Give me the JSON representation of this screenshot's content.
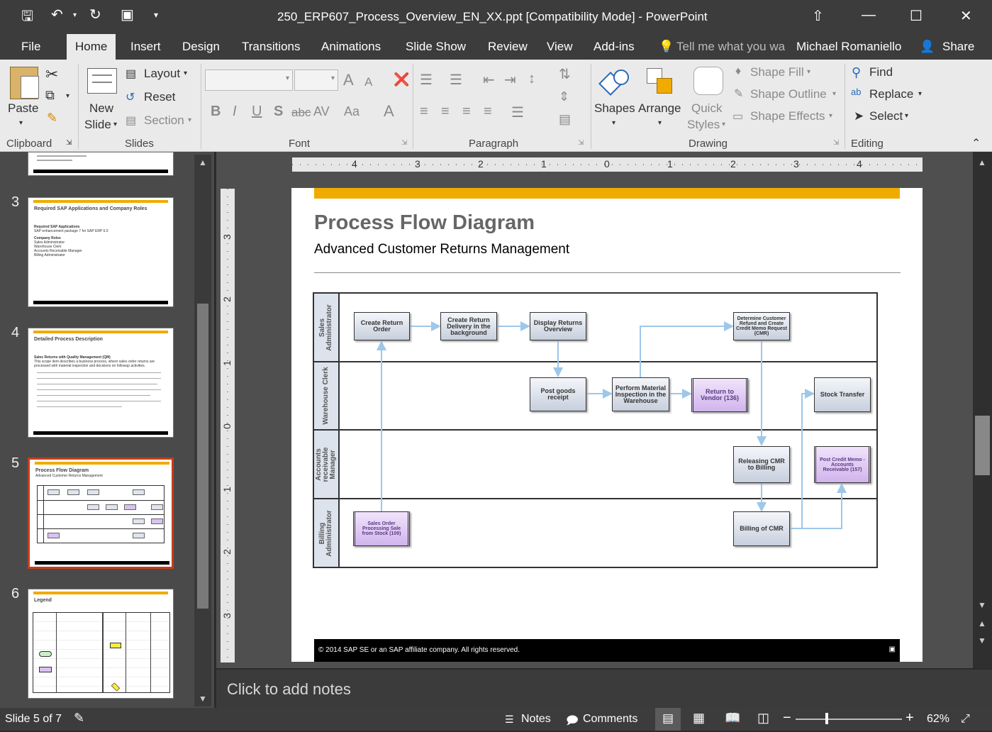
{
  "window": {
    "title": "250_ERP607_Process_Overview_EN_XX.ppt [Compatibility Mode] - PowerPoint",
    "quick_access": [
      "save-icon",
      "undo-icon",
      "redo-icon",
      "present-from-start-icon",
      "customize-icon"
    ]
  },
  "tabs": {
    "file": "File",
    "home": "Home",
    "insert": "Insert",
    "design": "Design",
    "transitions": "Transitions",
    "animations": "Animations",
    "slideshow": "Slide Show",
    "review": "Review",
    "view": "View",
    "addins": "Add-ins",
    "tellme": "Tell me what you wa",
    "user": "Michael Romaniello",
    "share": "Share"
  },
  "ribbon": {
    "clipboard": {
      "paste": "Paste",
      "group": "Clipboard"
    },
    "slides": {
      "new_slide_1": "New",
      "new_slide_2": "Slide",
      "layout": "Layout",
      "reset": "Reset",
      "section": "Section",
      "group": "Slides"
    },
    "font": {
      "bold": "B",
      "italic": "I",
      "underline": "U",
      "shadow": "S",
      "strike": "abc",
      "spacing": "AV",
      "case": "Aa",
      "color": "A",
      "grow": "A",
      "shrink": "A",
      "group": "Font"
    },
    "paragraph": {
      "group": "Paragraph"
    },
    "drawing": {
      "shapes": "Shapes",
      "arrange": "Arrange",
      "quick_1": "Quick",
      "quick_2": "Styles",
      "fill": "Shape Fill",
      "outline": "Shape Outline",
      "effects": "Shape Effects",
      "group": "Drawing"
    },
    "editing": {
      "find": "Find",
      "replace": "Replace",
      "select": "Select",
      "group": "Editing"
    }
  },
  "thumbnails": [
    {
      "num": "3",
      "title": "Required SAP Applications and Company Roles",
      "lines": [
        "Required SAP Applications",
        "SAP enhancement package 7 for SAP ERP 6.0",
        "Company Roles",
        "Sales Administrator",
        "Warehouse Clerk",
        "Accounts Receivable Manager",
        "Billing Administrator"
      ]
    },
    {
      "num": "4",
      "title": "Detailed Process Description",
      "lines": [
        "Sales Returns with Quality Management (QM)",
        "This scope item describes a business process, where sales order returns are processed with material inspection and decisions on followup activities."
      ]
    },
    {
      "num": "5",
      "title": "Process Flow Diagram",
      "subtitle": "Advanced Customer Returns Management"
    },
    {
      "num": "6",
      "title": "Legend"
    }
  ],
  "ruler": {
    "h": [
      "4",
      "3",
      "2",
      "1",
      "0",
      "1",
      "2",
      "3",
      "4"
    ],
    "v": [
      "3",
      "2",
      "1",
      "0",
      "1",
      "2",
      "3"
    ]
  },
  "slide": {
    "title": "Process Flow Diagram",
    "subtitle": "Advanced Customer Returns Management",
    "footer": "© 2014 SAP SE or an SAP affiliate company. All rights reserved.",
    "accent": "#f0ab00",
    "lanes": [
      "Sales\nAdministrator",
      "Warehouse Clerk",
      "Accounts\nreceivable\nManager",
      "Billing\nAdministrator"
    ],
    "boxes": {
      "create_return_order": "Create Return Order",
      "create_return_delivery": "Create Return Delivery in the background",
      "display_returns": "Display Returns Overview",
      "determine_refund": "Determine Customer Refund and Create Credit Memo Request (CMR)",
      "post_goods_receipt": "Post goods receipt",
      "perform_inspection": "Perform Material Inspection in the Warehouse",
      "return_to_vendor": "Return to Vendor (136)",
      "stock_transfer": "Stock Transfer",
      "releasing_cmr": "Releasing CMR to Billing",
      "post_credit_memo": "Post Credit Memo - Accounts Receivable (157)",
      "sales_order_processing": "Sales Order Processing Sale from Stock (109)",
      "billing_cmr": "Billing of CMR"
    }
  },
  "notes": "Click to add notes",
  "status": {
    "slide": "Slide 5 of 7",
    "notes": "Notes",
    "comments": "Comments",
    "zoom": "62%"
  }
}
